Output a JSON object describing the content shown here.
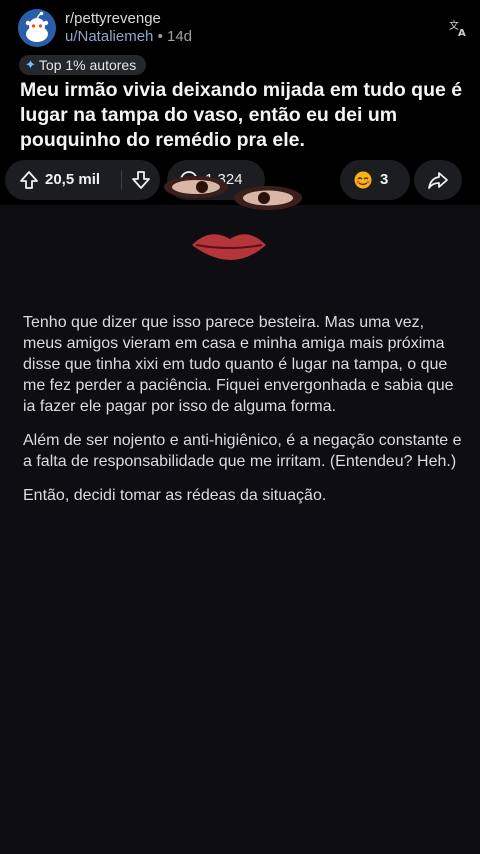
{
  "header": {
    "subreddit": "r/pettyrevenge",
    "username": "u/Nataliemeh",
    "separator": "•",
    "age": "14d",
    "translate_icon": "translate-icon",
    "avatar_icon": "reddit-snoo-avatar"
  },
  "flair": {
    "icon": "sparkle-icon",
    "label": "Top 1% autores"
  },
  "post": {
    "title": "Meu irmão vivia deixando mijada em tudo que é lugar na tampa do vaso, então eu dei um pouquinho do remédio pra ele."
  },
  "actions": {
    "score": "20,5 mil",
    "comments": "1.324",
    "awards": "3",
    "upvote_icon": "upvote-arrow-icon",
    "downvote_icon": "downvote-arrow-icon",
    "comment_icon": "comment-bubble-icon",
    "award_icon": "award-emoji-icon",
    "share_icon": "share-arrow-icon"
  },
  "body": {
    "paragraphs": [
      "Tenho que dizer que isso parece besteira. Mas uma vez, meus amigos vieram em casa e minha amiga mais próxima disse que tinha xixi em tudo quanto é lugar na tampa, o que me fez perder a paciência. Fiquei envergonhada e sabia que ia fazer ele pagar por isso de alguma forma.",
      "Além de ser nojento e anti-higiênico, é a negação constante e a falta de responsabilidade que me irritam. (Entendeu? Heh.)",
      "Então, decidi tomar as rédeas da situação."
    ]
  },
  "colors": {
    "background": "#000000",
    "content_background": "#0e0d12",
    "pill_background": "#1b1d20",
    "username": "#8fa6c9",
    "avatar": "#2a5ea8"
  }
}
